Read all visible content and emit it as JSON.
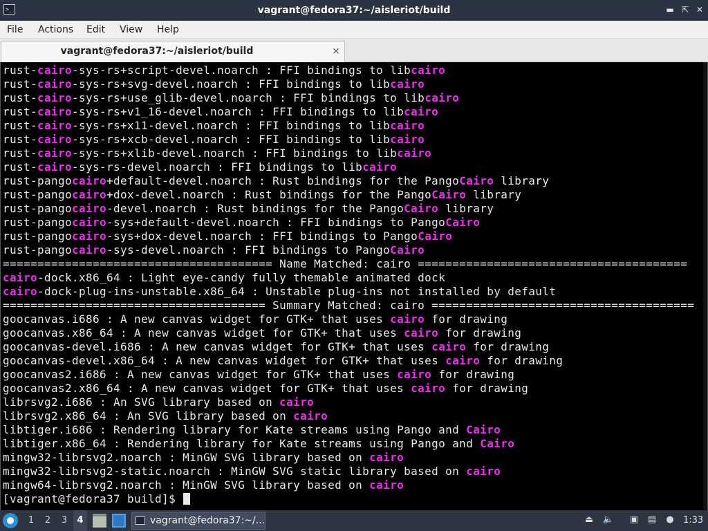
{
  "window": {
    "title": "vagrant@fedora37:~/aisleriot/build",
    "controls": {
      "minimize_icon": "minimize-icon",
      "maximize_icon": "maximize-icon",
      "close_icon": "close-icon"
    },
    "app_icon": "terminal-icon",
    "app_icon_text": ">_"
  },
  "menubar": {
    "items": [
      "File",
      "Actions",
      "Edit",
      "View",
      "Help"
    ]
  },
  "tabs": [
    {
      "label": "vagrant@fedora37:~/aisleriot/build",
      "close_glyph": "×"
    }
  ],
  "terminal": {
    "highlight_color": "#ee2cee",
    "lines": [
      [
        {
          "t": "rust-"
        },
        {
          "t": "cairo",
          "hl": true
        },
        {
          "t": "-sys-rs+script-devel.noarch : FFI bindings to lib"
        },
        {
          "t": "cairo",
          "hl": true
        }
      ],
      [
        {
          "t": "rust-"
        },
        {
          "t": "cairo",
          "hl": true
        },
        {
          "t": "-sys-rs+svg-devel.noarch : FFI bindings to lib"
        },
        {
          "t": "cairo",
          "hl": true
        }
      ],
      [
        {
          "t": "rust-"
        },
        {
          "t": "cairo",
          "hl": true
        },
        {
          "t": "-sys-rs+use_glib-devel.noarch : FFI bindings to lib"
        },
        {
          "t": "cairo",
          "hl": true
        }
      ],
      [
        {
          "t": "rust-"
        },
        {
          "t": "cairo",
          "hl": true
        },
        {
          "t": "-sys-rs+v1_16-devel.noarch : FFI bindings to lib"
        },
        {
          "t": "cairo",
          "hl": true
        }
      ],
      [
        {
          "t": "rust-"
        },
        {
          "t": "cairo",
          "hl": true
        },
        {
          "t": "-sys-rs+x11-devel.noarch : FFI bindings to lib"
        },
        {
          "t": "cairo",
          "hl": true
        }
      ],
      [
        {
          "t": "rust-"
        },
        {
          "t": "cairo",
          "hl": true
        },
        {
          "t": "-sys-rs+xcb-devel.noarch : FFI bindings to lib"
        },
        {
          "t": "cairo",
          "hl": true
        }
      ],
      [
        {
          "t": "rust-"
        },
        {
          "t": "cairo",
          "hl": true
        },
        {
          "t": "-sys-rs+xlib-devel.noarch : FFI bindings to lib"
        },
        {
          "t": "cairo",
          "hl": true
        }
      ],
      [
        {
          "t": "rust-"
        },
        {
          "t": "cairo",
          "hl": true
        },
        {
          "t": "-sys-rs-devel.noarch : FFI bindings to lib"
        },
        {
          "t": "cairo",
          "hl": true
        }
      ],
      [
        {
          "t": "rust-pango"
        },
        {
          "t": "cairo",
          "hl": true
        },
        {
          "t": "+default-devel.noarch : Rust bindings for the Pango"
        },
        {
          "t": "Cairo",
          "hl": true
        },
        {
          "t": " library"
        }
      ],
      [
        {
          "t": "rust-pango"
        },
        {
          "t": "cairo",
          "hl": true
        },
        {
          "t": "+dox-devel.noarch : Rust bindings for the Pango"
        },
        {
          "t": "Cairo",
          "hl": true
        },
        {
          "t": " library"
        }
      ],
      [
        {
          "t": "rust-pango"
        },
        {
          "t": "cairo",
          "hl": true
        },
        {
          "t": "-devel.noarch : Rust bindings for the Pango"
        },
        {
          "t": "Cairo",
          "hl": true
        },
        {
          "t": " library"
        }
      ],
      [
        {
          "t": "rust-pango"
        },
        {
          "t": "cairo",
          "hl": true
        },
        {
          "t": "-sys+default-devel.noarch : FFI bindings to Pango"
        },
        {
          "t": "Cairo",
          "hl": true
        }
      ],
      [
        {
          "t": "rust-pango"
        },
        {
          "t": "cairo",
          "hl": true
        },
        {
          "t": "-sys+dox-devel.noarch : FFI bindings to Pango"
        },
        {
          "t": "Cairo",
          "hl": true
        }
      ],
      [
        {
          "t": "rust-pango"
        },
        {
          "t": "cairo",
          "hl": true
        },
        {
          "t": "-sys-devel.noarch : FFI bindings to Pango"
        },
        {
          "t": "Cairo",
          "hl": true
        }
      ],
      [
        {
          "t": "======================================= Name Matched: cairo ======================================="
        }
      ],
      [
        {
          "t": "cairo",
          "hl": true
        },
        {
          "t": "-dock.x86_64 : Light eye-candy fully themable animated dock"
        }
      ],
      [
        {
          "t": "cairo",
          "hl": true
        },
        {
          "t": "-dock-plug-ins-unstable.x86_64 : Unstable plug-ins not installed by default"
        }
      ],
      [
        {
          "t": "====================================== Summary Matched: cairo ======================================"
        }
      ],
      [
        {
          "t": "goocanvas.i686 : A new canvas widget for GTK+ that uses "
        },
        {
          "t": "cairo",
          "hl": true
        },
        {
          "t": " for drawing"
        }
      ],
      [
        {
          "t": "goocanvas.x86_64 : A new canvas widget for GTK+ that uses "
        },
        {
          "t": "cairo",
          "hl": true
        },
        {
          "t": " for drawing"
        }
      ],
      [
        {
          "t": "goocanvas-devel.i686 : A new canvas widget for GTK+ that uses "
        },
        {
          "t": "cairo",
          "hl": true
        },
        {
          "t": " for drawing"
        }
      ],
      [
        {
          "t": "goocanvas-devel.x86_64 : A new canvas widget for GTK+ that uses "
        },
        {
          "t": "cairo",
          "hl": true
        },
        {
          "t": " for drawing"
        }
      ],
      [
        {
          "t": "goocanvas2.i686 : A new canvas widget for GTK+ that uses "
        },
        {
          "t": "cairo",
          "hl": true
        },
        {
          "t": " for drawing"
        }
      ],
      [
        {
          "t": "goocanvas2.x86_64 : A new canvas widget for GTK+ that uses "
        },
        {
          "t": "cairo",
          "hl": true
        },
        {
          "t": " for drawing"
        }
      ],
      [
        {
          "t": "librsvg2.i686 : An SVG library based on "
        },
        {
          "t": "cairo",
          "hl": true
        }
      ],
      [
        {
          "t": "librsvg2.x86_64 : An SVG library based on "
        },
        {
          "t": "cairo",
          "hl": true
        }
      ],
      [
        {
          "t": "libtiger.i686 : Rendering library for Kate streams using Pango and "
        },
        {
          "t": "Cairo",
          "hl": true
        }
      ],
      [
        {
          "t": "libtiger.x86_64 : Rendering library for Kate streams using Pango and "
        },
        {
          "t": "Cairo",
          "hl": true
        }
      ],
      [
        {
          "t": "mingw32-librsvg2.noarch : MinGW SVG library based on "
        },
        {
          "t": "cairo",
          "hl": true
        }
      ],
      [
        {
          "t": "mingw32-librsvg2-static.noarch : MinGW SVG static library based on "
        },
        {
          "t": "cairo",
          "hl": true
        }
      ],
      [
        {
          "t": "mingw64-librsvg2.noarch : MinGW SVG library based on "
        },
        {
          "t": "cairo",
          "hl": true
        }
      ]
    ],
    "prompt": "[vagrant@fedora37 build]$ "
  },
  "taskbar": {
    "start_icon": "fedora-menu-icon",
    "workspaces": [
      "1",
      "2",
      "3",
      "4"
    ],
    "active_workspace": "4",
    "launchers": [
      "files-icon",
      "show-desktop-icon"
    ],
    "task_label": "vagrant@fedora37:~/...",
    "tray_icons": [
      "eject-icon",
      "volume-icon",
      "network-icon",
      "clipboard-icon",
      "notification-icon"
    ],
    "clock": "1:33"
  }
}
